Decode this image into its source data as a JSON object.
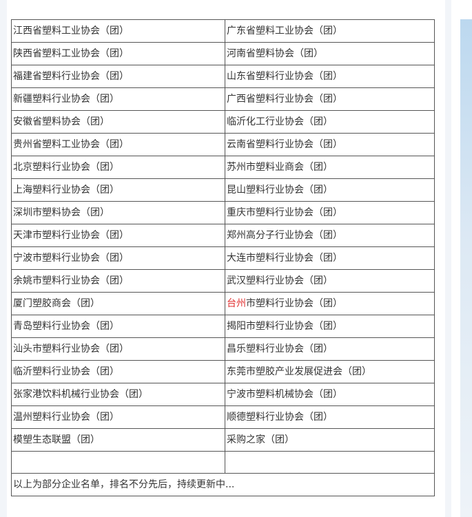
{
  "rows": [
    [
      "江西省塑料工业协会（团）",
      "广东省塑料工业协会（团）"
    ],
    [
      "陕西省塑料工业协会（团）",
      "河南省塑料协会（团）"
    ],
    [
      "福建省塑料行业协会（团）",
      "山东省塑料行业协会（团）"
    ],
    [
      "新疆塑料行业协会（团）",
      "广西省塑料行业协会（团）"
    ],
    [
      "安徽省塑料协会（团）",
      "临沂化工行业协会（团）"
    ],
    [
      "贵州省塑料工业协会（团）",
      "云南省塑料行业协会（团）"
    ],
    [
      "北京塑料行业协会（团）",
      "苏州市塑料业商会（团）"
    ],
    [
      "上海塑料行业协会（团）",
      "昆山塑料行业协会（团）"
    ],
    [
      "深圳市塑料协会（团）",
      "重庆市塑料行业协会（团）"
    ],
    [
      "天津市塑料行业协会（团）",
      "郑州高分子行业协会（团）"
    ],
    [
      "宁波市塑料行业协会（团）",
      "大连市塑料行业协会（团）"
    ],
    [
      "余姚市塑料行业协会（团）",
      "武汉塑料行业协会（团）"
    ],
    [
      "厦门塑胶商会（团）",
      "台州市塑料行业协会（团）"
    ],
    [
      "青岛塑料行业协会（团）",
      "揭阳市塑料行业协会（团）"
    ],
    [
      "汕头市塑料行业协会（团）",
      "昌乐塑料行业协会（团）"
    ],
    [
      "临沂塑料行业协会（团）",
      "东莞市塑胶产业发展促进会（团）"
    ],
    [
      "张家港饮料机械行业协会（团）",
      "宁波市塑料机械协会（团）"
    ],
    [
      "温州塑料行业协会（团）",
      "顺德塑料行业协会（团）"
    ],
    [
      "模塑生态联盟（团）",
      "采购之家（团）"
    ],
    [
      "",
      ""
    ]
  ],
  "highlight": {
    "prefix": "台州",
    "rest": "市塑料行业协会（团）",
    "color": "#e02f2f"
  },
  "footer_note": "以上为部分企业名单，排名不分先后，持续更新中..."
}
